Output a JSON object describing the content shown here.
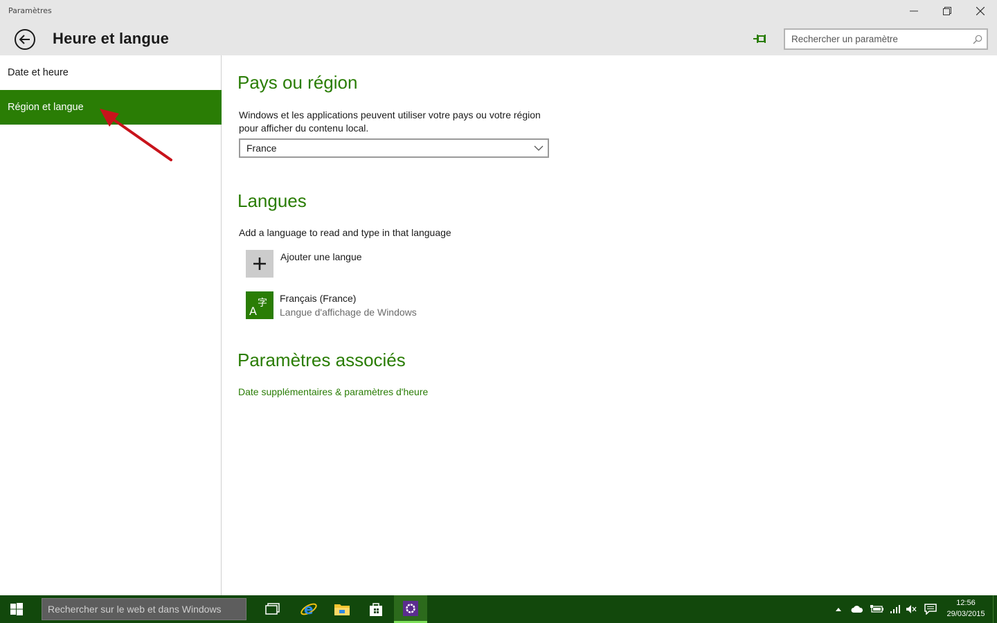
{
  "window": {
    "title": "Paramètres"
  },
  "header": {
    "page_title": "Heure et langue",
    "search_placeholder": "Rechercher un paramètre"
  },
  "sidebar": {
    "items": [
      {
        "label": "Date et heure",
        "active": false
      },
      {
        "label": "Région et langue",
        "active": true
      }
    ]
  },
  "main": {
    "region": {
      "title": "Pays ou région",
      "description_line1": "Windows et les applications peuvent utiliser votre pays ou votre région",
      "description_line2": "pour afficher du contenu local.",
      "selected_country": "France"
    },
    "languages": {
      "title": "Langues",
      "description": "Add a language to read and type in that language",
      "add_label": "Ajouter une langue",
      "items": [
        {
          "name": "Français (France)",
          "subtitle": "Langue d'affichage de Windows"
        }
      ]
    },
    "related": {
      "title": "Paramètres associés",
      "link": "Date supplémentaires & paramètres d'heure"
    }
  },
  "taskbar": {
    "search_placeholder": "Rechercher sur le web et dans Windows",
    "clock_time": "12:56",
    "clock_date": "29/03/2015",
    "apps": [
      "task-view-icon",
      "internet-explorer-icon",
      "file-explorer-icon",
      "store-icon",
      "settings-icon"
    ]
  },
  "colors": {
    "accent": "#2a7d05",
    "taskbar": "#12480c",
    "annotation": "#c8131b"
  }
}
